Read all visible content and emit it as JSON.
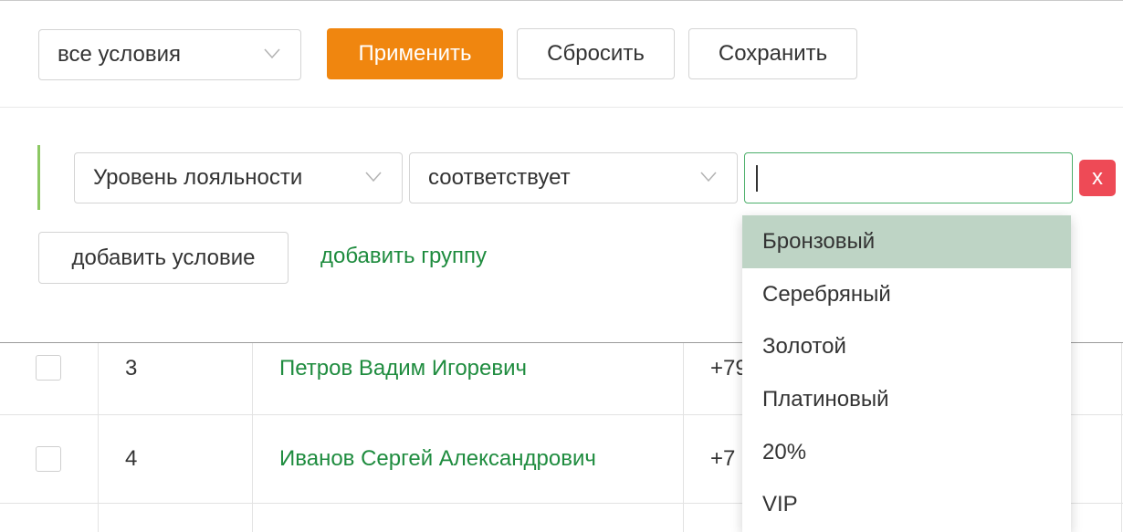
{
  "toolbar": {
    "condition_select": "все условия",
    "apply_label": "Применить",
    "reset_label": "Сбросить",
    "save_label": "Сохранить"
  },
  "filter": {
    "field_select": "Уровень лояльности",
    "operator_select": "соответствует",
    "value_input": "",
    "delete_label": "x",
    "add_condition_label": "добавить условие",
    "add_group_label": "добавить группу"
  },
  "dropdown": {
    "options": [
      "Бронзовый",
      "Серебряный",
      "Золотой",
      "Платиновый",
      "20%",
      "VIP"
    ],
    "highlighted": "Бронзовый"
  },
  "table": {
    "rows": [
      {
        "num": "3",
        "name": "Петров Вадим Игоревич",
        "phone": "+79"
      },
      {
        "num": "4",
        "name": "Иванов Сергей Александрович",
        "phone": "+7"
      }
    ]
  },
  "colors": {
    "accent": "#f0860f",
    "link": "#1f8c3f",
    "delete": "#ee4a56",
    "highlight": "#bed4c5",
    "group_bar": "#8cc863"
  }
}
